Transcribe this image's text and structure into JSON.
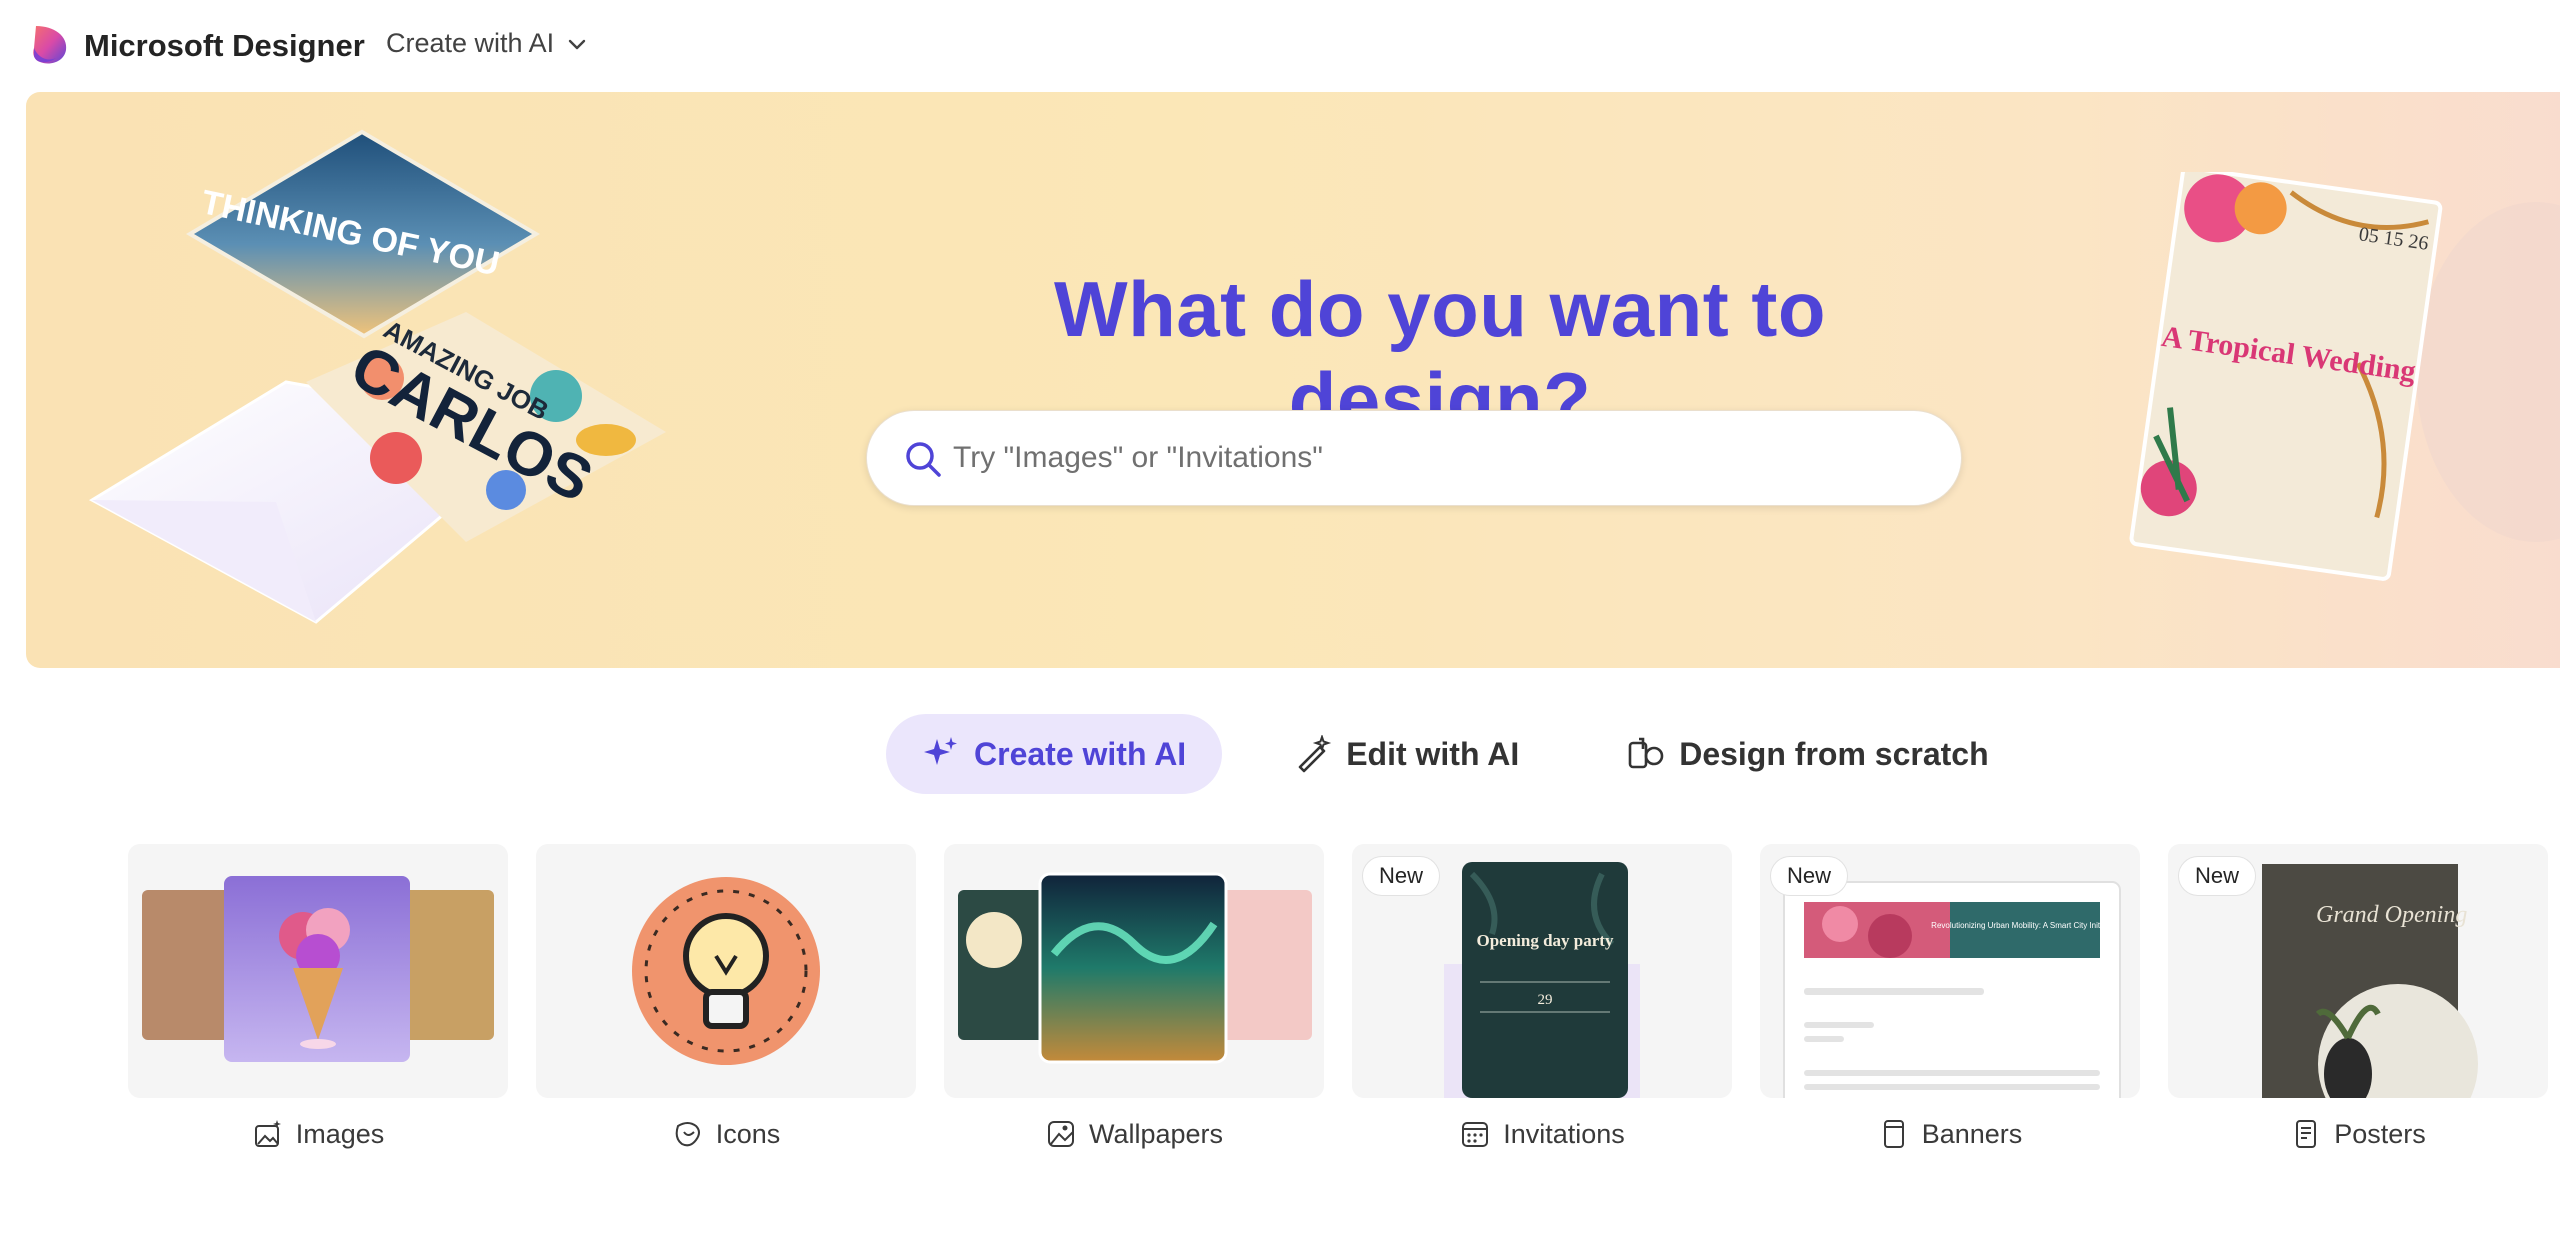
{
  "header": {
    "brand": "Microsoft Designer",
    "mode_dropdown": "Create with AI"
  },
  "hero": {
    "title": "What do you want to design?",
    "search_placeholder": "Try \"Images\" or \"Invitations\"",
    "accent_color": "#4f44d7"
  },
  "tabs": [
    {
      "label": "Create with AI",
      "icon": "sparkle-icon",
      "active": true
    },
    {
      "label": "Edit with AI",
      "icon": "magic-wand-icon",
      "active": false
    },
    {
      "label": "Design from scratch",
      "icon": "shapes-icon",
      "active": false
    }
  ],
  "categories": [
    {
      "label": "Images",
      "icon": "image-sparkle-icon",
      "badge": ""
    },
    {
      "label": "Icons",
      "icon": "sticker-icon",
      "badge": ""
    },
    {
      "label": "Wallpapers",
      "icon": "wallpaper-icon",
      "badge": ""
    },
    {
      "label": "Invitations",
      "icon": "calendar-icon",
      "badge": "New"
    },
    {
      "label": "Banners",
      "icon": "phone-banner-icon",
      "badge": "New"
    },
    {
      "label": "Posters",
      "icon": "document-icon",
      "badge": "New"
    }
  ],
  "art": {
    "card_thinking": "THINKING OF YOU",
    "card_amazing": "AMAZING JOB",
    "card_carlos": "CARLOS",
    "wedding_dates": "05 15 26",
    "wedding_title": "A Tropical Wedding",
    "invite_title": "Opening day party",
    "invite_day": "29",
    "banner_title": "Revolutionizing Urban Mobility: A Smart City Initiative",
    "poster_title": "Grand Opening"
  }
}
